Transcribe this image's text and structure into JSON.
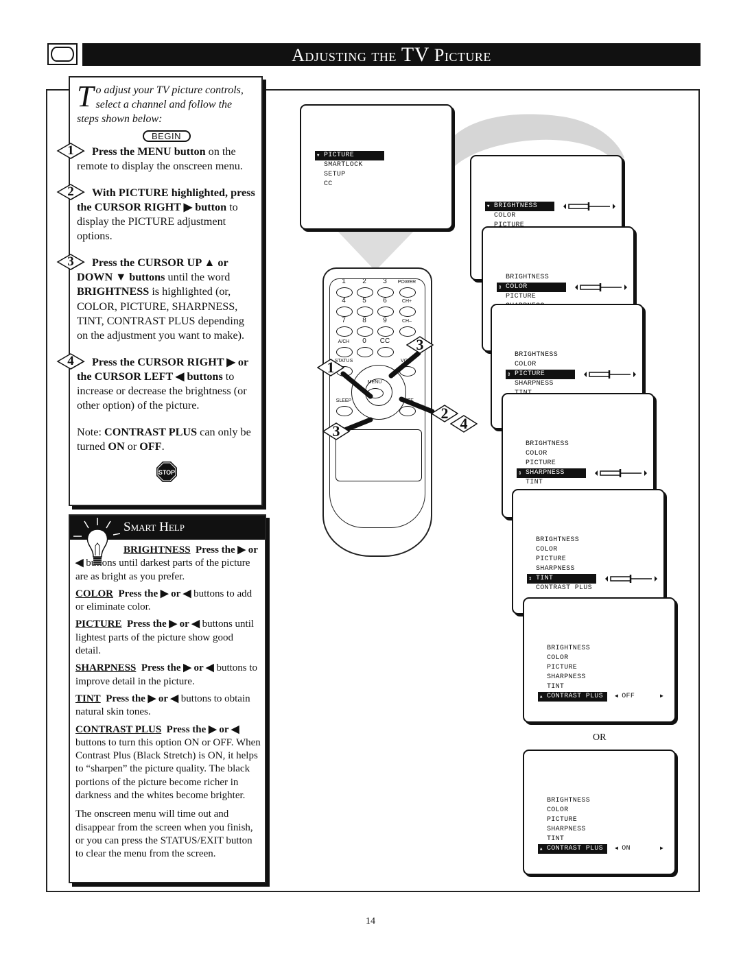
{
  "header": {
    "title_pre": "Adjusting the ",
    "title_tv": "TV",
    "title_post": " Picture"
  },
  "intro": {
    "drop": "T",
    "text": "o adjust your TV picture controls, select a channel and follow the steps shown below:",
    "begin": "BEGIN"
  },
  "steps": [
    {
      "num": "1",
      "segments": [
        {
          "t": "Press the MENU button",
          "b": true
        },
        {
          "t": " on the remote to display the onscreen menu.",
          "b": false
        }
      ]
    },
    {
      "num": "2",
      "segments": [
        {
          "t": "With PICTURE highlighted, press the CURSOR RIGHT ▶ button",
          "b": true
        },
        {
          "t": " to display the PICTURE adjustment options.",
          "b": false
        }
      ]
    },
    {
      "num": "3",
      "segments": [
        {
          "t": "Press the CURSOR UP ▲ or DOWN ▼ buttons",
          "b": true
        },
        {
          "t": " until the word ",
          "b": false
        },
        {
          "t": "BRIGHTNESS",
          "b": true
        },
        {
          "t": " is highlighted (or, COLOR, PICTURE, SHARPNESS, TINT, CONTRAST PLUS depending on the adjustment you want to make).",
          "b": false
        }
      ]
    },
    {
      "num": "4",
      "segments": [
        {
          "t": "Press the CURSOR RIGHT ▶ or the CURSOR LEFT ◀ buttons",
          "b": true
        },
        {
          "t": " to increase or decrease the brightness (or other option) of the picture.",
          "b": false
        }
      ]
    }
  ],
  "note": [
    {
      "t": "Note: ",
      "b": false
    },
    {
      "t": "CONTRAST PLUS",
      "b": true
    },
    {
      "t": " can only be turned ",
      "b": false
    },
    {
      "t": "ON",
      "b": true
    },
    {
      "t": " or ",
      "b": false
    },
    {
      "t": "OFF",
      "b": true
    },
    {
      "t": ".",
      "b": false
    }
  ],
  "stop_label": "STOP",
  "smart_help": {
    "title": "Smart Help",
    "items": [
      {
        "key": "BRIGHTNESS",
        "action": "Press the ▶ or ◀",
        "text": " buttons until darkest parts of the picture are as bright as you prefer."
      },
      {
        "key": "COLOR",
        "action": "Press the ▶ or ◀",
        "text": " buttons to add or eliminate color."
      },
      {
        "key": "PICTURE",
        "action": "Press the ▶ or ◀",
        "text": " buttons until lightest parts of the picture show good detail."
      },
      {
        "key": "SHARPNESS",
        "action": "Press the ▶ or ◀",
        "text": " buttons to improve detail in the picture."
      },
      {
        "key": "TINT",
        "action": "Press the ▶ or ◀",
        "text": " buttons to obtain natural skin tones."
      },
      {
        "key": "CONTRAST PLUS",
        "action": "Press the ▶ or ◀",
        "text": " buttons to turn this option ON or OFF. When Contrast Plus (Black Stretch) is ON, it helps to “sharpen” the picture quality. The black portions of the picture become richer in darkness and the whites become brighter."
      }
    ],
    "footer": "The onscreen menu will time out and disappear from the screen when you finish, or you can press the STATUS/EXIT button to clear the menu from the screen."
  },
  "remote": {
    "keys": [
      "1",
      "2",
      "3",
      "POWER",
      "4",
      "5",
      "6",
      "CH+",
      "7",
      "8",
      "9",
      "CH–",
      "A/CH",
      "0",
      "CC",
      "STATUS",
      "VOL–",
      "MENU",
      "SLEEP",
      "MUTE"
    ],
    "callouts": [
      "1",
      "3",
      "2",
      "4",
      "3"
    ]
  },
  "screens": [
    {
      "items": [
        "PICTURE",
        "SMARTLOCK",
        "SETUP",
        "CC"
      ],
      "highlight": 0,
      "marker": "down",
      "control": "arrow"
    },
    {
      "items": [
        "BRIGHTNESS",
        "COLOR",
        "PICTURE"
      ],
      "highlight": 0,
      "marker": "down",
      "control": "slider",
      "value": 0.5
    },
    {
      "items": [
        "BRIGHTNESS",
        "COLOR",
        "PICTURE",
        "SHARPNESS"
      ],
      "highlight": 1,
      "marker": "updown",
      "control": "slider",
      "value": 0.5
    },
    {
      "items": [
        "BRIGHTNESS",
        "COLOR",
        "PICTURE",
        "SHARPNESS",
        "TINT"
      ],
      "highlight": 2,
      "marker": "updown",
      "control": "slider",
      "value": 0.5
    },
    {
      "items": [
        "BRIGHTNESS",
        "COLOR",
        "PICTURE",
        "SHARPNESS",
        "TINT"
      ],
      "highlight": 3,
      "marker": "updown",
      "control": "slider",
      "value": 0.5
    },
    {
      "items": [
        "BRIGHTNESS",
        "COLOR",
        "PICTURE",
        "SHARPNESS",
        "TINT",
        "CONTRAST PLUS"
      ],
      "highlight": 4,
      "marker": "updown",
      "control": "slider",
      "value": 0.5
    },
    {
      "items": [
        "BRIGHTNESS",
        "COLOR",
        "PICTURE",
        "SHARPNESS",
        "TINT",
        "CONTRAST PLUS"
      ],
      "highlight": 5,
      "marker": "up",
      "control": "toggle",
      "state": "OFF"
    },
    {
      "items": [
        "BRIGHTNESS",
        "COLOR",
        "PICTURE",
        "SHARPNESS",
        "TINT",
        "CONTRAST PLUS"
      ],
      "highlight": 5,
      "marker": "up",
      "control": "toggle",
      "state": "ON"
    }
  ],
  "or_label": "OR",
  "page_number": "14"
}
